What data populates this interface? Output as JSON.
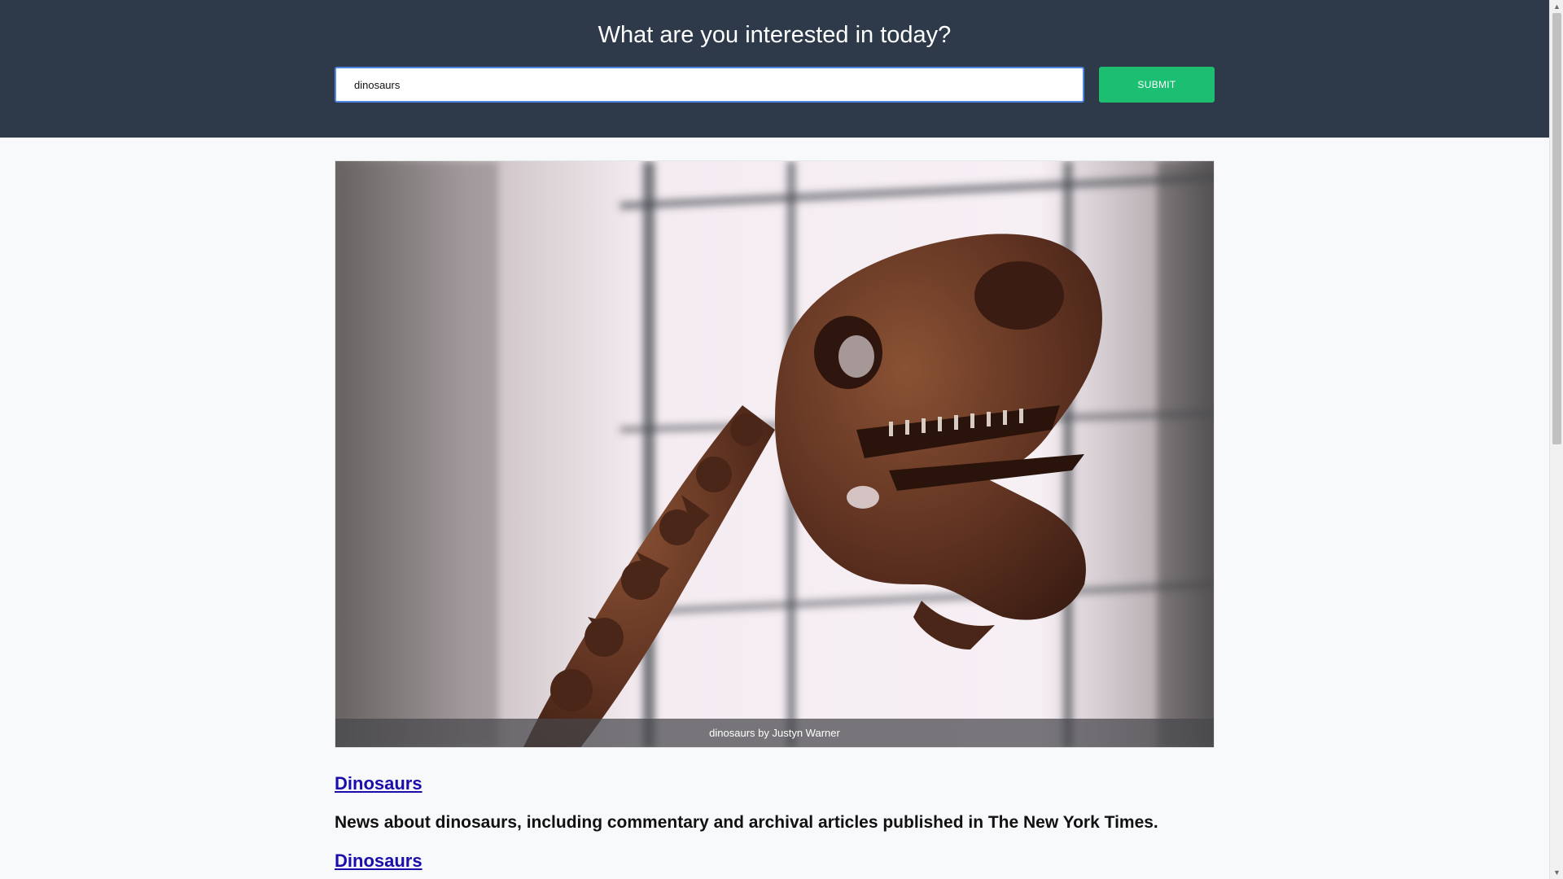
{
  "header": {
    "title": "What are you interested in today?",
    "search_value": "dinosaurs",
    "search_placeholder": "",
    "submit_label": "SUBMIT"
  },
  "hero": {
    "caption": "dinosaurs by Justyn Warner",
    "image_subject": "dinosaur skeleton skull in museum"
  },
  "results": [
    {
      "title": "Dinosaurs",
      "description": "News about dinosaurs, including commentary and archival articles published in The New York Times."
    },
    {
      "title": "Dinosaurs"
    }
  ],
  "scrollbar": {
    "up_arrow": "▲",
    "down_arrow": "▼"
  },
  "colors": {
    "header_bg": "#2e3a4a",
    "submit_bg": "#1cbf72",
    "link": "#1a0dab",
    "page_bg": "#f8f9fb",
    "input_border": "#4f86e8"
  }
}
